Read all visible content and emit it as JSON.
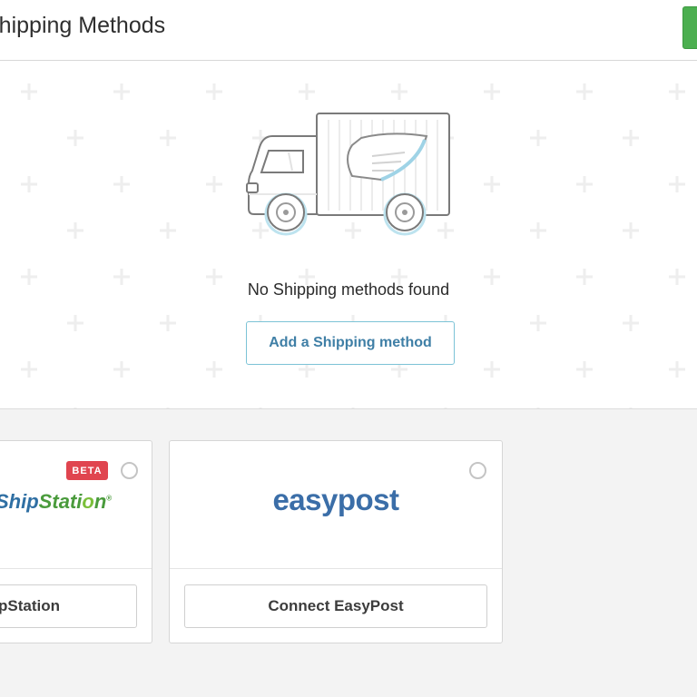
{
  "header": {
    "title": "Shipping Methods",
    "primary_button_color": "#4caf50"
  },
  "empty_state": {
    "illustration": "delivery-truck-icon",
    "message": "No Shipping methods found",
    "add_button_label": "Add a Shipping method"
  },
  "integrations": [
    {
      "name": "ShipStation",
      "logo_text": "ShipStation",
      "badge": "BETA",
      "button_label": "Connect ShipStation",
      "selected": false
    },
    {
      "name": "EasyPost",
      "logo_text": "easypost",
      "badge": "",
      "button_label": "Connect EasyPost",
      "selected": false
    }
  ],
  "colors": {
    "accent_link": "#3f7fa6",
    "badge_red": "#e0454f",
    "easypost_blue": "#3b6ea8",
    "shipstation_green": "#4a9b3c"
  }
}
